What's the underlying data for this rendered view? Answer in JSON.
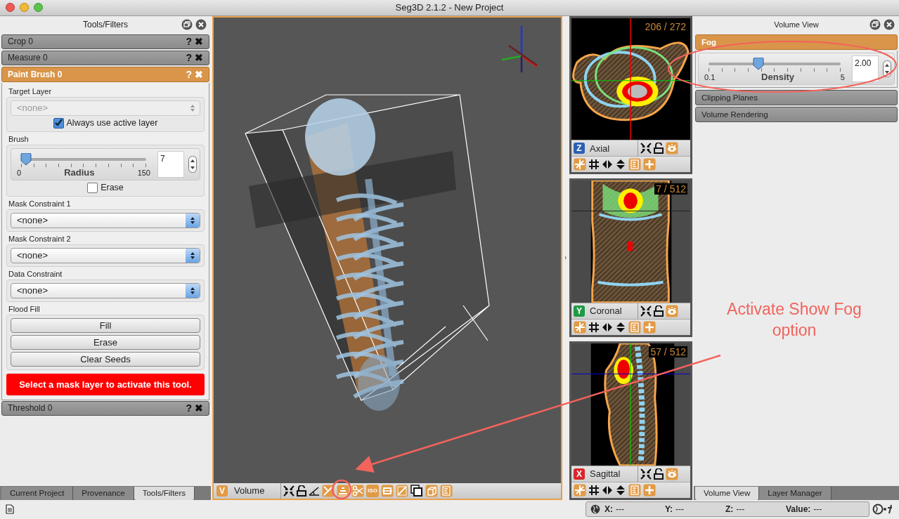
{
  "window": {
    "title": "Seg3D 2.1.2  - New Project"
  },
  "tools_panel": {
    "title": "Tools/Filters",
    "tools": [
      {
        "label": "Crop 0",
        "expanded": false,
        "help": "?",
        "close": "✖"
      },
      {
        "label": "Measure 0",
        "expanded": false,
        "help": "?",
        "close": "✖"
      },
      {
        "label": "Paint Brush 0",
        "expanded": true,
        "help": "?",
        "close": "✖"
      },
      {
        "label": "Threshold 0",
        "expanded": false,
        "help": "?",
        "close": "✖"
      }
    ],
    "paint_brush": {
      "target_layer": {
        "label": "Target Layer",
        "value": "<none>",
        "disabled": true
      },
      "always_use_active": {
        "label": "Always use active layer",
        "checked": true
      },
      "brush": {
        "label": "Brush",
        "min": "0",
        "max": "150",
        "name": "Radius",
        "level": 0.04,
        "value": "7"
      },
      "erase": {
        "label": "Erase",
        "checked": false
      },
      "constraints": [
        {
          "label": "Mask Constraint 1",
          "value": "<none>"
        },
        {
          "label": "Mask Constraint 2",
          "value": "<none>"
        },
        {
          "label": "Data Constraint",
          "value": "<none>"
        }
      ],
      "flood_fill": {
        "label": "Flood Fill",
        "buttons": [
          "Fill",
          "Erase",
          "Clear Seeds"
        ]
      },
      "warning": "Select a mask layer to activate this tool."
    },
    "tabs": [
      {
        "label": "Current Project",
        "selected": false
      },
      {
        "label": "Provenance",
        "selected": false
      },
      {
        "label": "Tools/Filters",
        "selected": true
      }
    ]
  },
  "volume_viewer": {
    "badge": "V",
    "label": "Volume",
    "iso": "ISO"
  },
  "slice_viewers": [
    {
      "badge": "Z",
      "label": "Axial",
      "slice": "206 / 272",
      "color": "#2d5fb5"
    },
    {
      "badge": "Y",
      "label": "Coronal",
      "slice": "7 / 512",
      "color": "#1f9a45"
    },
    {
      "badge": "X",
      "label": "Sagittal",
      "slice": "57 / 512",
      "color": "#d9262a"
    }
  ],
  "volume_view_panel": {
    "title": "Volume View",
    "sections": [
      {
        "label": "Fog",
        "expanded": true
      },
      {
        "label": "Clipping Planes",
        "expanded": false
      },
      {
        "label": "Volume Rendering",
        "expanded": false
      }
    ],
    "fog": {
      "min": "0.1",
      "max": "5",
      "name": "Density",
      "level": 0.38,
      "value": "2.00"
    },
    "tabs": [
      {
        "label": "Volume View",
        "selected": true
      },
      {
        "label": "Layer Manager",
        "selected": false
      }
    ]
  },
  "status_bar": {
    "fields": [
      {
        "label": "X:",
        "value": "---"
      },
      {
        "label": "Y:",
        "value": "---"
      },
      {
        "label": "Z:",
        "value": "---"
      },
      {
        "label": "Value:",
        "value": "---"
      }
    ]
  },
  "annotation": {
    "text": "Activate Show Fog option"
  }
}
